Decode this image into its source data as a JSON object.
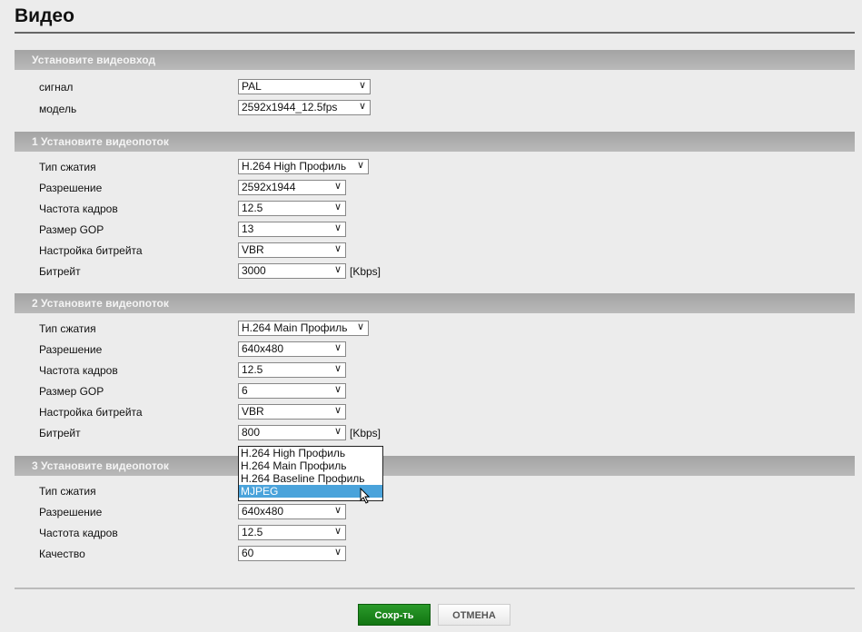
{
  "title": "Видео",
  "video_input": {
    "header": "Установите видеовход",
    "signal_label": "сигнал",
    "signal": "PAL",
    "model_label": "модель",
    "model": "2592x1944_12.5fps"
  },
  "streams": [
    {
      "header": "1 Установите видеопоток",
      "compression_label": "Тип сжатия",
      "compression": "H.264 High Профиль",
      "resolution_label": "Разрешение",
      "resolution": "2592x1944",
      "fps_label": "Частота кадров",
      "fps": "12.5",
      "gop_label": "Размер GOP",
      "gop": "13",
      "bitrate_mode_label": "Настройка битрейта",
      "bitrate_mode": "VBR",
      "bitrate_label": "Битрейт",
      "bitrate": "3000",
      "unit": "[Kbps]"
    },
    {
      "header": "2 Установите видеопоток",
      "compression_label": "Тип сжатия",
      "compression": "H.264 Main Профиль",
      "resolution_label": "Разрешение",
      "resolution": "640x480",
      "fps_label": "Частота кадров",
      "fps": "12.5",
      "gop_label": "Размер GOP",
      "gop": "6",
      "bitrate_mode_label": "Настройка битрейта",
      "bitrate_mode": "VBR",
      "bitrate_label": "Битрейт",
      "bitrate": "800",
      "unit": "[Kbps]"
    },
    {
      "header": "3 Установите видеопоток",
      "compression_label": "Тип сжатия",
      "resolution_label": "Разрешение",
      "resolution": "640x480",
      "fps_label": "Частота кадров",
      "fps": "12.5",
      "quality_label": "Качество",
      "quality": "60"
    }
  ],
  "dropdown_options": [
    "H.264 High Профиль",
    "H.264 Main Профиль",
    "H.264 Baseline Профиль",
    "MJPEG"
  ],
  "dropdown_highlighted": "MJPEG",
  "buttons": {
    "save": "Сохр-ть",
    "cancel": "ОТМЕНА"
  }
}
